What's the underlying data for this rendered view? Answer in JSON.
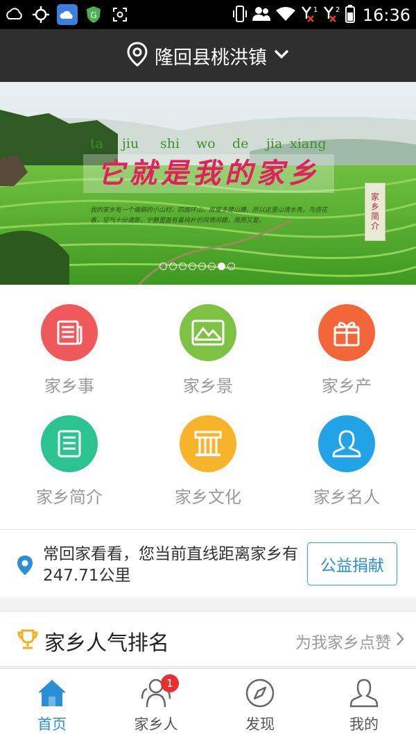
{
  "status_bar": {
    "time": "16:36",
    "left_icons": [
      "weather-icon",
      "location-icon",
      "cloud-app-icon",
      "shield-app-icon",
      "screenshot-icon"
    ],
    "right_icons": [
      "vibrate-icon",
      "contacts-icon",
      "wifi-icon",
      "signal-1-icon",
      "signal-2-icon",
      "battery-icon"
    ],
    "sim_labels": [
      "1",
      "2"
    ]
  },
  "header": {
    "location": "隆回县桃洪镇",
    "icons": [
      "location-pin-icon",
      "chevron-down-icon"
    ]
  },
  "banner": {
    "pinyin": [
      "ta",
      "jiu",
      "shi",
      "wo",
      "de",
      "jia",
      "xiang"
    ],
    "slogan": "它就是我的家乡",
    "tag": "家乡简介",
    "poem": "我的家乡有一个偏僻的小山村，四面环山，房屋多建山腰，所以这里山清水秀，鸟语花香，空气十分清新，宁静里面有着纯朴的风情闲趣，周而又复。",
    "pages": 8,
    "active_page": 6
  },
  "grid": [
    {
      "label": "家乡事",
      "color": "#f0595c",
      "icon": "news-icon"
    },
    {
      "label": "家乡景",
      "color": "#7dc242",
      "icon": "landscape-icon"
    },
    {
      "label": "家乡产",
      "color": "#f2663a",
      "icon": "gift-icon"
    },
    {
      "label": "家乡简介",
      "color": "#2bc38f",
      "icon": "list-icon"
    },
    {
      "label": "家乡文化",
      "color": "#f7b42b",
      "icon": "pillar-icon"
    },
    {
      "label": "家乡名人",
      "color": "#22a3e8",
      "icon": "person-icon"
    }
  ],
  "distance": {
    "text": "常回家看看，您当前直线距离家乡有247.71公里",
    "button": "公益捐献",
    "icon": "location-pin-icon",
    "accent": "#2a8fd6"
  },
  "rank": {
    "title": "家乡人气排名",
    "more": "为我家乡点赞",
    "icon": "trophy-icon"
  },
  "tabs": [
    {
      "label": "首页",
      "icon": "home-icon",
      "active": true
    },
    {
      "label": "家乡人",
      "icon": "people-icon",
      "badge": "1"
    },
    {
      "label": "发现",
      "icon": "compass-icon"
    },
    {
      "label": "我的",
      "icon": "user-icon"
    }
  ]
}
